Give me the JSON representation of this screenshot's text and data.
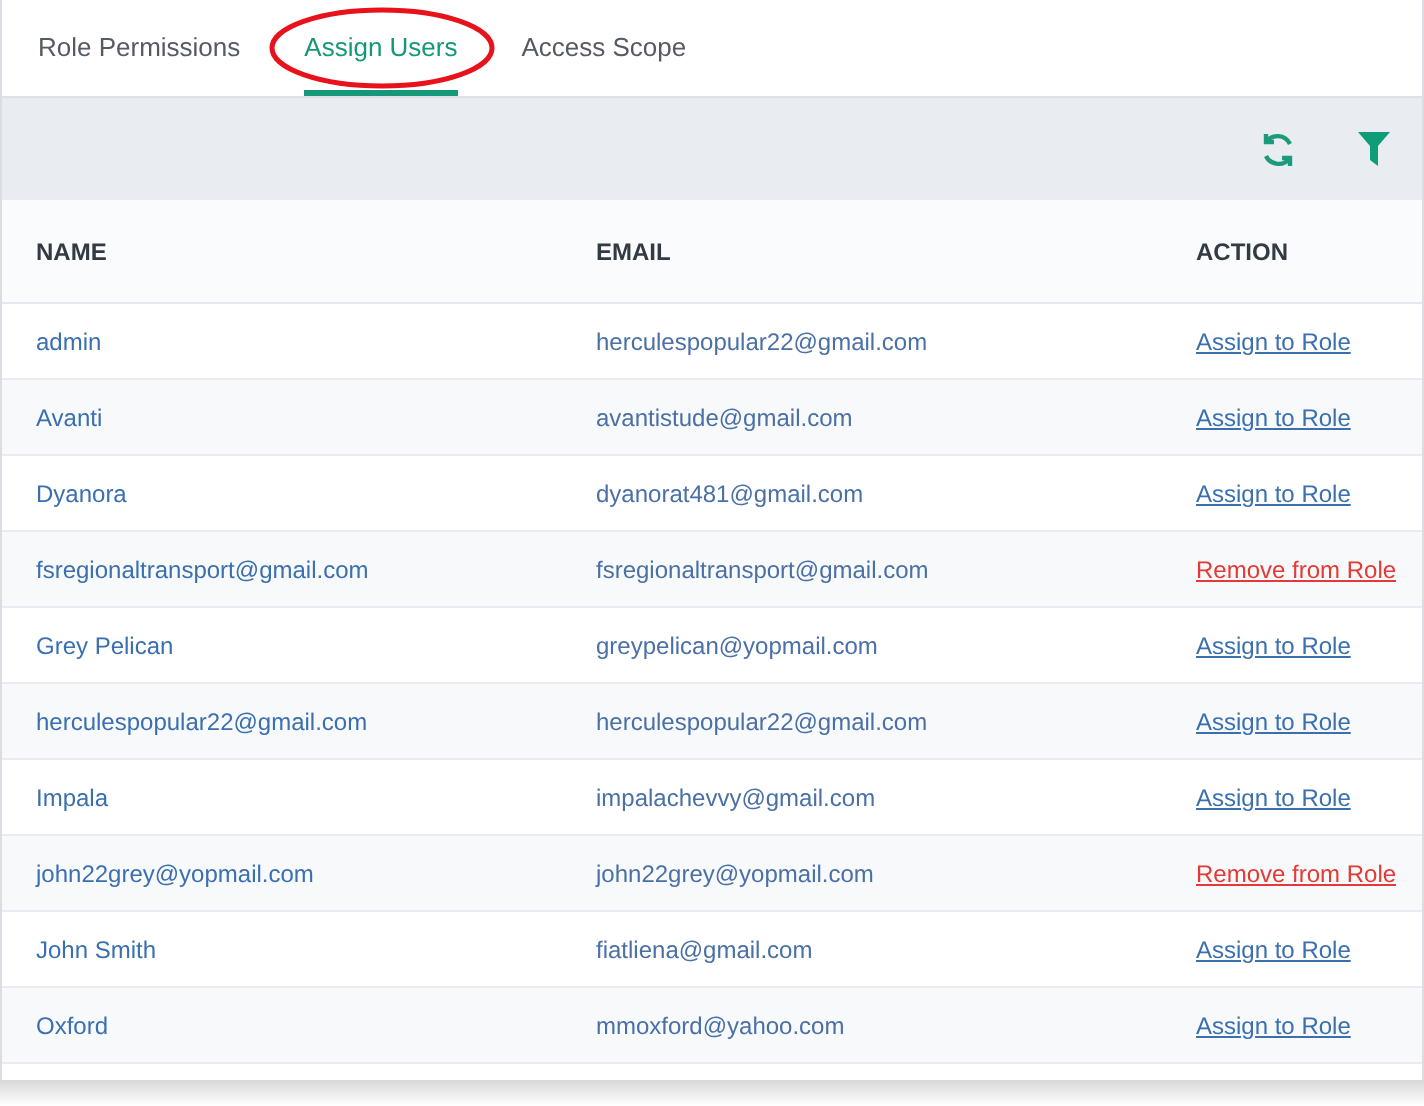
{
  "tabs": [
    {
      "label": "Role Permissions",
      "selected": false,
      "highlighted": false
    },
    {
      "label": "Assign Users",
      "selected": true,
      "highlighted": true
    },
    {
      "label": "Access Scope",
      "selected": false,
      "highlighted": false
    }
  ],
  "table": {
    "columns": [
      "NAME",
      "EMAIL",
      "ACTION"
    ],
    "rows": [
      {
        "name": "admin",
        "email": "herculespopular22@gmail.com",
        "action": "Assign to Role",
        "kind": "assign"
      },
      {
        "name": "Avanti",
        "email": "avantistude@gmail.com",
        "action": "Assign to Role",
        "kind": "assign"
      },
      {
        "name": "Dyanora",
        "email": "dyanorat481@gmail.com",
        "action": "Assign to Role",
        "kind": "assign"
      },
      {
        "name": "fsregionaltransport@gmail.com",
        "email": "fsregionaltransport@gmail.com",
        "action": "Remove from Role",
        "kind": "remove"
      },
      {
        "name": "Grey Pelican",
        "email": "greypelican@yopmail.com",
        "action": "Assign to Role",
        "kind": "assign"
      },
      {
        "name": "herculespopular22@gmail.com",
        "email": "herculespopular22@gmail.com",
        "action": "Assign to Role",
        "kind": "assign"
      },
      {
        "name": "Impala",
        "email": "impalachevvy@gmail.com",
        "action": "Assign to Role",
        "kind": "assign"
      },
      {
        "name": "john22grey@yopmail.com",
        "email": "john22grey@yopmail.com",
        "action": "Remove from Role",
        "kind": "remove"
      },
      {
        "name": "John Smith",
        "email": "fiatliena@gmail.com",
        "action": "Assign to Role",
        "kind": "assign"
      },
      {
        "name": "Oxford",
        "email": "mmoxford@yahoo.com",
        "action": "Assign to Role",
        "kind": "assign"
      }
    ]
  }
}
